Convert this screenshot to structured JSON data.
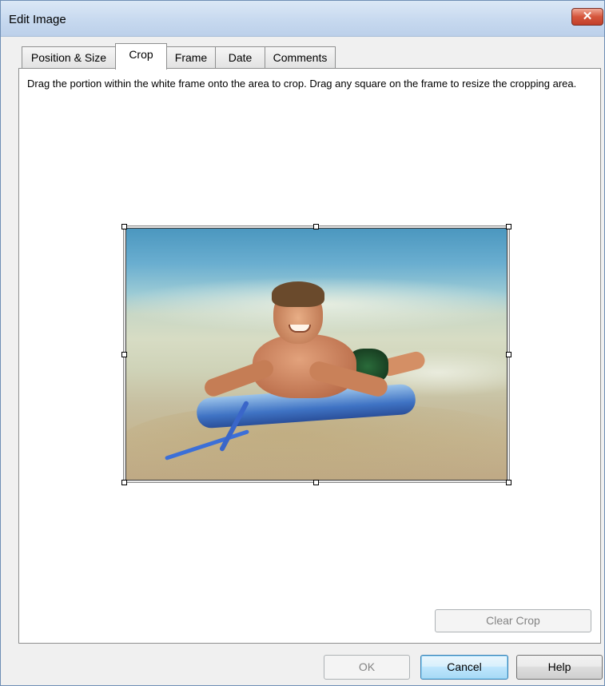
{
  "window": {
    "title": "Edit Image",
    "close_label": "✕"
  },
  "tabs": [
    {
      "label": "Position & Size",
      "active": false
    },
    {
      "label": "Crop",
      "active": true
    },
    {
      "label": "Frame",
      "active": false
    },
    {
      "label": "Date",
      "active": false
    },
    {
      "label": "Comments",
      "active": false
    }
  ],
  "crop": {
    "instructions": "Drag the portion within the white frame onto the area to crop. Drag any square on the frame to resize the cropping area.",
    "image": {
      "description_icon": "photo-image"
    },
    "clear_crop_label": "Clear Crop",
    "clear_crop_enabled": false
  },
  "footer": {
    "ok_label": "OK",
    "ok_enabled": false,
    "cancel_label": "Cancel",
    "help_label": "Help"
  },
  "colors": {
    "title_bar": "#c7d9ef",
    "close_button": "#d5553c",
    "dialog_background": "#f0f0f0",
    "panel_background": "#ffffff"
  }
}
